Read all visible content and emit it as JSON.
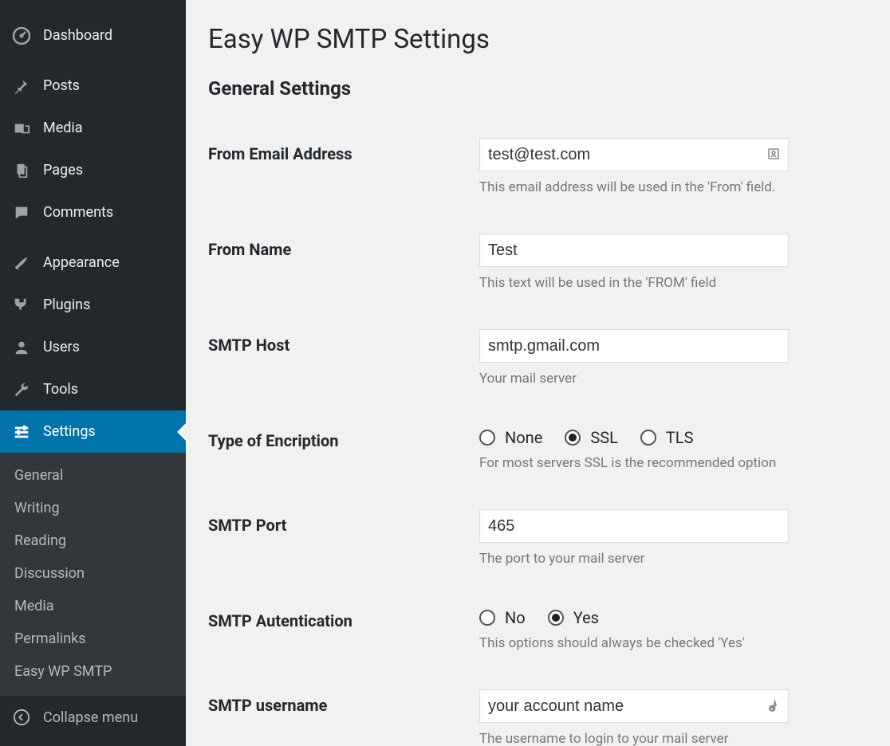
{
  "sidebar": {
    "items": [
      {
        "id": "dashboard",
        "label": "Dashboard"
      },
      {
        "id": "posts",
        "label": "Posts"
      },
      {
        "id": "media",
        "label": "Media"
      },
      {
        "id": "pages",
        "label": "Pages"
      },
      {
        "id": "comments",
        "label": "Comments"
      },
      {
        "id": "appearance",
        "label": "Appearance"
      },
      {
        "id": "plugins",
        "label": "Plugins"
      },
      {
        "id": "users",
        "label": "Users"
      },
      {
        "id": "tools",
        "label": "Tools"
      },
      {
        "id": "settings",
        "label": "Settings"
      }
    ],
    "submenu": [
      {
        "label": "General"
      },
      {
        "label": "Writing"
      },
      {
        "label": "Reading"
      },
      {
        "label": "Discussion"
      },
      {
        "label": "Media"
      },
      {
        "label": "Permalinks"
      },
      {
        "label": "Easy WP SMTP"
      }
    ],
    "collapse_label": "Collapse menu"
  },
  "page": {
    "title": "Easy WP SMTP Settings",
    "section": "General Settings"
  },
  "form": {
    "from_email": {
      "label": "From Email Address",
      "value": "test@test.com",
      "helper": "This email address will be used in the 'From' field."
    },
    "from_name": {
      "label": "From Name",
      "value": "Test",
      "helper": "This text will be used in the 'FROM' field"
    },
    "smtp_host": {
      "label": "SMTP Host",
      "value": "smtp.gmail.com",
      "helper": "Your mail server"
    },
    "encryption": {
      "label": "Type of Encription",
      "options": [
        "None",
        "SSL",
        "TLS"
      ],
      "selected": "SSL",
      "helper": "For most servers SSL is the recommended option"
    },
    "smtp_port": {
      "label": "SMTP Port",
      "value": "465",
      "helper": "The port to your mail server"
    },
    "smtp_auth": {
      "label": "SMTP Autentication",
      "options": [
        "No",
        "Yes"
      ],
      "selected": "Yes",
      "helper": "This options should always be checked 'Yes'"
    },
    "smtp_user": {
      "label": "SMTP username",
      "value": "your account name",
      "helper": "The username to login to your mail server"
    }
  }
}
